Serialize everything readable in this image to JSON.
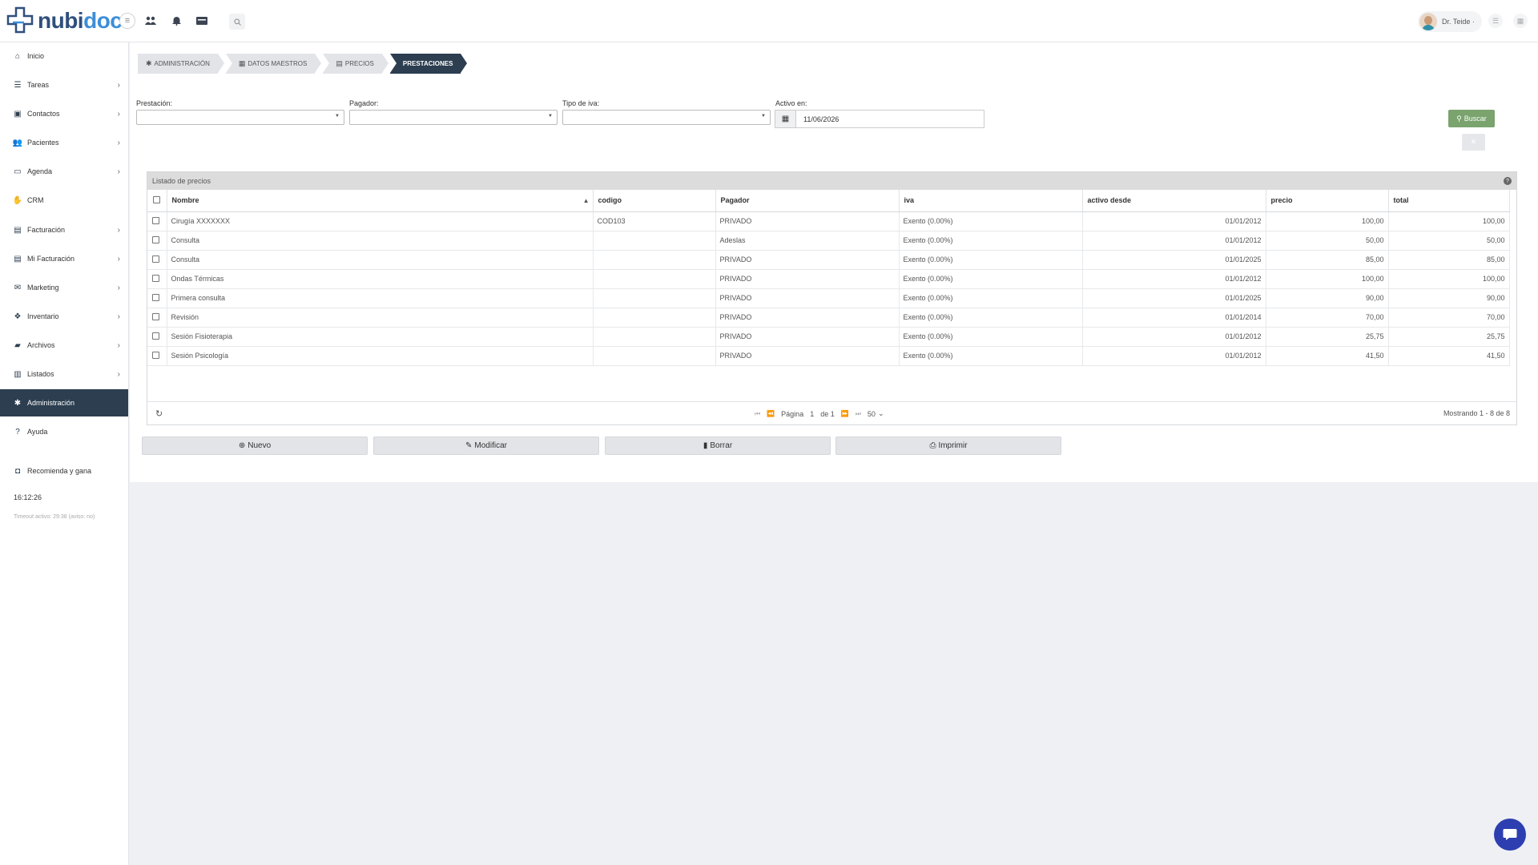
{
  "brand": {
    "part1": "nubi",
    "part2": "doc"
  },
  "header": {
    "user_name": "Dr. Teide ·"
  },
  "sidebar": {
    "items": [
      {
        "label": "Inicio",
        "icon": "home-icon",
        "glyph": "⌂",
        "chevron": false
      },
      {
        "label": "Tareas",
        "icon": "list-icon",
        "glyph": "☰",
        "chevron": true
      },
      {
        "label": "Contactos",
        "icon": "address-book-icon",
        "glyph": "▣",
        "chevron": true
      },
      {
        "label": "Pacientes",
        "icon": "users-icon",
        "glyph": "👥",
        "chevron": true
      },
      {
        "label": "Agenda",
        "icon": "calendar-icon",
        "glyph": "▭",
        "chevron": true
      },
      {
        "label": "CRM",
        "icon": "handshake-icon",
        "glyph": "✋",
        "chevron": false
      },
      {
        "label": "Facturación",
        "icon": "money-icon",
        "glyph": "▤",
        "chevron": true
      },
      {
        "label": "Mi Facturación",
        "icon": "money-icon",
        "glyph": "▤",
        "chevron": true
      },
      {
        "label": "Marketing",
        "icon": "envelope-icon",
        "glyph": "✉",
        "chevron": true
      },
      {
        "label": "Inventario",
        "icon": "cubes-icon",
        "glyph": "❖",
        "chevron": true
      },
      {
        "label": "Archivos",
        "icon": "folder-icon",
        "glyph": "▰",
        "chevron": true
      },
      {
        "label": "Listados",
        "icon": "chart-icon",
        "glyph": "▥",
        "chevron": true
      },
      {
        "label": "Administración",
        "icon": "gear-icon",
        "glyph": "✱",
        "chevron": false,
        "active": true
      },
      {
        "label": "Ayuda",
        "icon": "question-icon",
        "glyph": "?",
        "chevron": false
      },
      {
        "label": "Recomienda y gana",
        "icon": "gift-icon",
        "glyph": "◘",
        "chevron": false
      }
    ],
    "time": "16:12:26",
    "timeout": "Timeout activo: 29:38 (aviso: no)"
  },
  "breadcrumb": [
    {
      "label": "ADMINISTRACIÓN",
      "icon": "gear-icon",
      "glyph": "✱"
    },
    {
      "label": "DATOS MAESTROS",
      "icon": "table-icon",
      "glyph": "▦"
    },
    {
      "label": "PRECIOS",
      "icon": "money-icon",
      "glyph": "▤"
    },
    {
      "label": "PRESTACIONES",
      "icon": "",
      "glyph": "",
      "active": true
    }
  ],
  "filters": {
    "prestacion_label": "Prestación:",
    "pagador_label": "Pagador:",
    "tipo_iva_label": "Tipo de iva:",
    "activo_label": "Activo en:",
    "activo_value": "11/06/2026",
    "search_label": "Buscar"
  },
  "grid": {
    "title": "Listado de precios",
    "columns": [
      "Nombre",
      "codigo",
      "Pagador",
      "iva",
      "activo desde",
      "precio",
      "total"
    ],
    "rows": [
      [
        "Cirugía XXXXXXX",
        "COD103",
        "PRIVADO",
        "Exento (0.00%)",
        "01/01/2012",
        "100,00",
        "100,00"
      ],
      [
        "Consulta",
        "",
        "Adeslas",
        "Exento (0.00%)",
        "01/01/2012",
        "50,00",
        "50,00"
      ],
      [
        "Consulta",
        "",
        "PRIVADO",
        "Exento (0.00%)",
        "01/01/2025",
        "85,00",
        "85,00"
      ],
      [
        "Ondas Térmicas",
        "",
        "PRIVADO",
        "Exento (0.00%)",
        "01/01/2012",
        "100,00",
        "100,00"
      ],
      [
        "Primera consulta",
        "",
        "PRIVADO",
        "Exento (0.00%)",
        "01/01/2025",
        "90,00",
        "90,00"
      ],
      [
        "Revisión",
        "",
        "PRIVADO",
        "Exento (0.00%)",
        "01/01/2014",
        "70,00",
        "70,00"
      ],
      [
        "Sesión Fisioterapia",
        "",
        "PRIVADO",
        "Exento (0.00%)",
        "01/01/2012",
        "25,75",
        "25,75"
      ],
      [
        "Sesión Psicología",
        "",
        "PRIVADO",
        "Exento (0.00%)",
        "01/01/2012",
        "41,50",
        "41,50"
      ]
    ],
    "pager": {
      "page_label": "Página",
      "page": "1",
      "of_label": "de 1",
      "page_size": "50",
      "info": "Mostrando 1 - 8 de 8"
    }
  },
  "actions": [
    {
      "label": "Nuevo",
      "icon": "plus-circle-icon",
      "glyph": "⊕"
    },
    {
      "label": "Modificar",
      "icon": "pencil-icon",
      "glyph": "✎"
    },
    {
      "label": "Borrar",
      "icon": "trash-icon",
      "glyph": "▮"
    },
    {
      "label": "Imprimir",
      "icon": "print-icon",
      "glyph": "⎙"
    }
  ],
  "colors": {
    "brand_dark": "#2f4f7c",
    "brand_light": "#3d8ed8",
    "nav_active": "#2c3e50",
    "search_button": "#7aa36e",
    "chat_button": "#2d3eb0"
  }
}
